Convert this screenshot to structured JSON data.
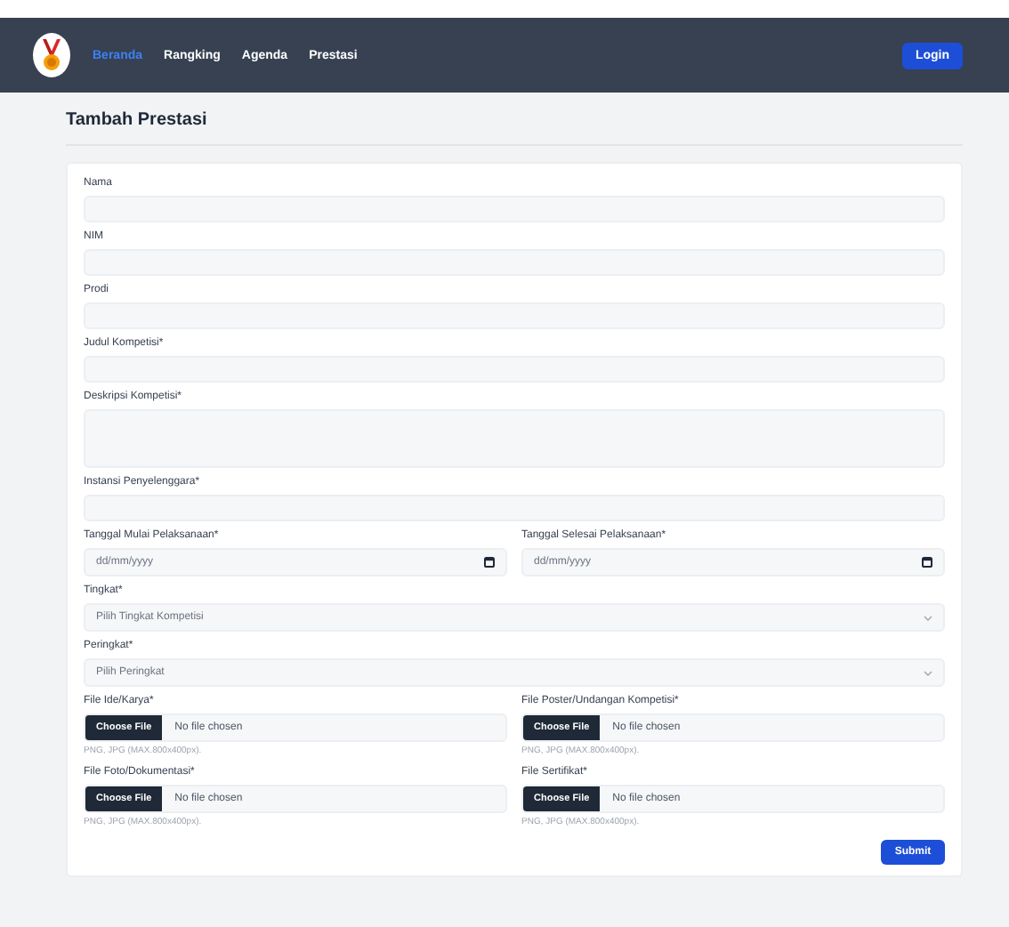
{
  "navbar": {
    "items": [
      {
        "label": "Beranda",
        "selected": true
      },
      {
        "label": "Rangking",
        "selected": false
      },
      {
        "label": "Agenda",
        "selected": false
      },
      {
        "label": "Prestasi",
        "selected": false
      }
    ],
    "login": "Login"
  },
  "page_title": "Tambah Prestasi",
  "form": {
    "rows": [
      [
        {
          "kind": "text",
          "label": "Nama"
        }
      ],
      [
        {
          "kind": "text",
          "label": "NIM"
        }
      ],
      [
        {
          "kind": "text",
          "label": "Prodi"
        }
      ],
      [
        {
          "kind": "text",
          "label": "Judul Kompetisi*"
        }
      ],
      [
        {
          "kind": "textarea",
          "label": "Deskripsi Kompetisi*"
        }
      ],
      [
        {
          "kind": "text",
          "label": "Instansi Penyelenggara*"
        }
      ],
      [
        {
          "kind": "date",
          "label": "Tanggal Mulai Pelaksanaan*",
          "placeholder": "dd/mm/yyyy"
        },
        {
          "kind": "date",
          "label": "Tanggal Selesai Pelaksanaan*",
          "placeholder": "dd/mm/yyyy"
        }
      ],
      [
        {
          "kind": "select",
          "label": "Tingkat*",
          "value": "Pilih Tingkat Kompetisi"
        }
      ],
      [
        {
          "kind": "select",
          "label": "Peringkat*",
          "value": "Pilih Peringkat"
        }
      ],
      [
        {
          "kind": "file",
          "label": "File Ide/Karya*",
          "button": "Choose File",
          "status": "No file chosen",
          "hint": "PNG, JPG (MAX.800x400px)."
        },
        {
          "kind": "file",
          "label": "File Poster/Undangan Kompetisi*",
          "button": "Choose File",
          "status": "No file chosen",
          "hint": "PNG, JPG (MAX.800x400px)."
        }
      ],
      [
        {
          "kind": "file",
          "label": "File Foto/Dokumentasi*",
          "button": "Choose File",
          "status": "No file chosen",
          "hint": "PNG, JPG (MAX.800x400px)."
        },
        {
          "kind": "file",
          "label": "File Sertifikat*",
          "button": "Choose File",
          "status": "No file chosen",
          "hint": "PNG, JPG (MAX.800x400px)."
        }
      ]
    ],
    "submit": "Submit"
  }
}
